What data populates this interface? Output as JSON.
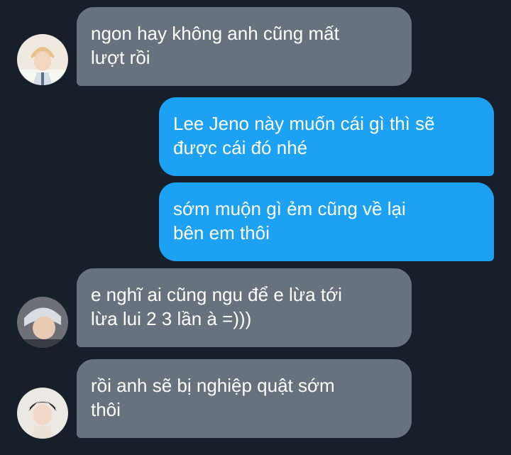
{
  "messages": [
    {
      "sender": "other",
      "text": "ngon hay không anh cũng mất\nlượt rồi"
    },
    {
      "sender": "me",
      "text": "Lee Jeno này muốn cái gì thì sẽ\nđược cái đó nhé"
    },
    {
      "sender": "me",
      "text": "sớm muộn gì ẻm cũng về lại\nbên em thôi"
    },
    {
      "sender": "other",
      "text": "e nghĩ ai cũng ngu để e lừa tới\nlừa lui 2 3 lần à =)))"
    },
    {
      "sender": "other",
      "text": "rồi anh sẽ bị nghiệp quật sớm\nthôi"
    }
  ],
  "colors": {
    "background": "#17202a",
    "received_bubble": "#66737f",
    "sent_bubble": "#1da1f2",
    "text": "#ffffff"
  }
}
